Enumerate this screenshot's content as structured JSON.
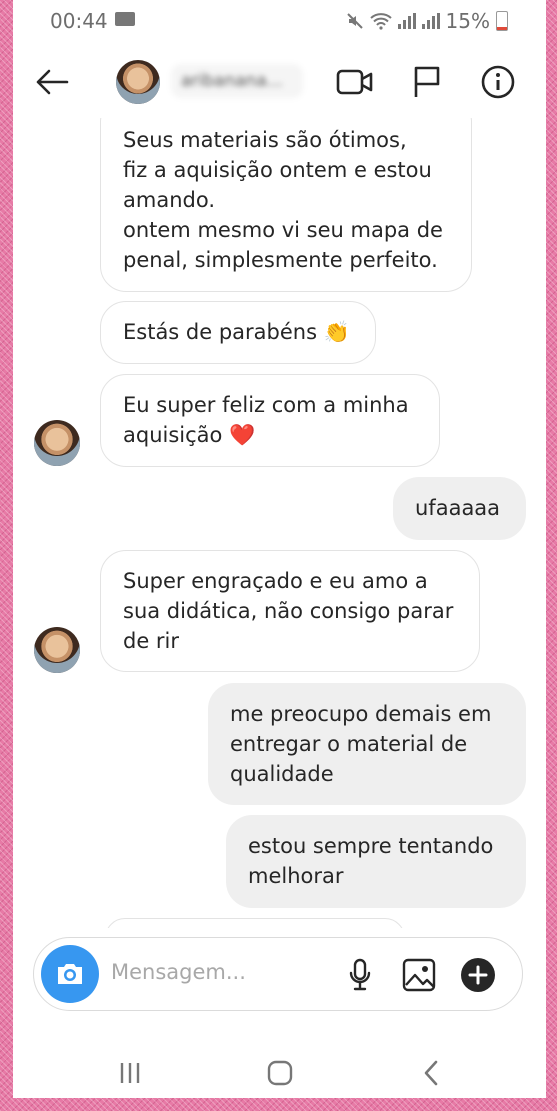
{
  "status_bar": {
    "time": "00:44",
    "battery": "15%"
  },
  "header": {
    "username": "aribanana..."
  },
  "messages": [
    {
      "text": "Seus materiais são ótimos,\nfiz a aquisição ontem e estou\namando.\nontem mesmo vi seu mapa de\npenal, simplesmente perfeito.",
      "direction": "received"
    },
    {
      "text": "Estás de parabéns 👏",
      "direction": "received"
    },
    {
      "text": "Eu super feliz com a minha\naquisição ❤️",
      "direction": "received"
    },
    {
      "text": "ufaaaaa",
      "direction": "sent"
    },
    {
      "text": "Super engraçado e eu amo a\nsua didática, não consigo parar\nde rir",
      "direction": "received"
    },
    {
      "text": "me preocupo demais em\nentregar o material de\nqualidade",
      "direction": "sent"
    },
    {
      "text": "estou sempre tentando\nmelhorar",
      "direction": "sent"
    }
  ],
  "composer": {
    "placeholder": "Mensagem..."
  },
  "colors": {
    "accent": "#3797f0",
    "sent_bubble": "#efefef",
    "frame": "#e77aa6"
  }
}
